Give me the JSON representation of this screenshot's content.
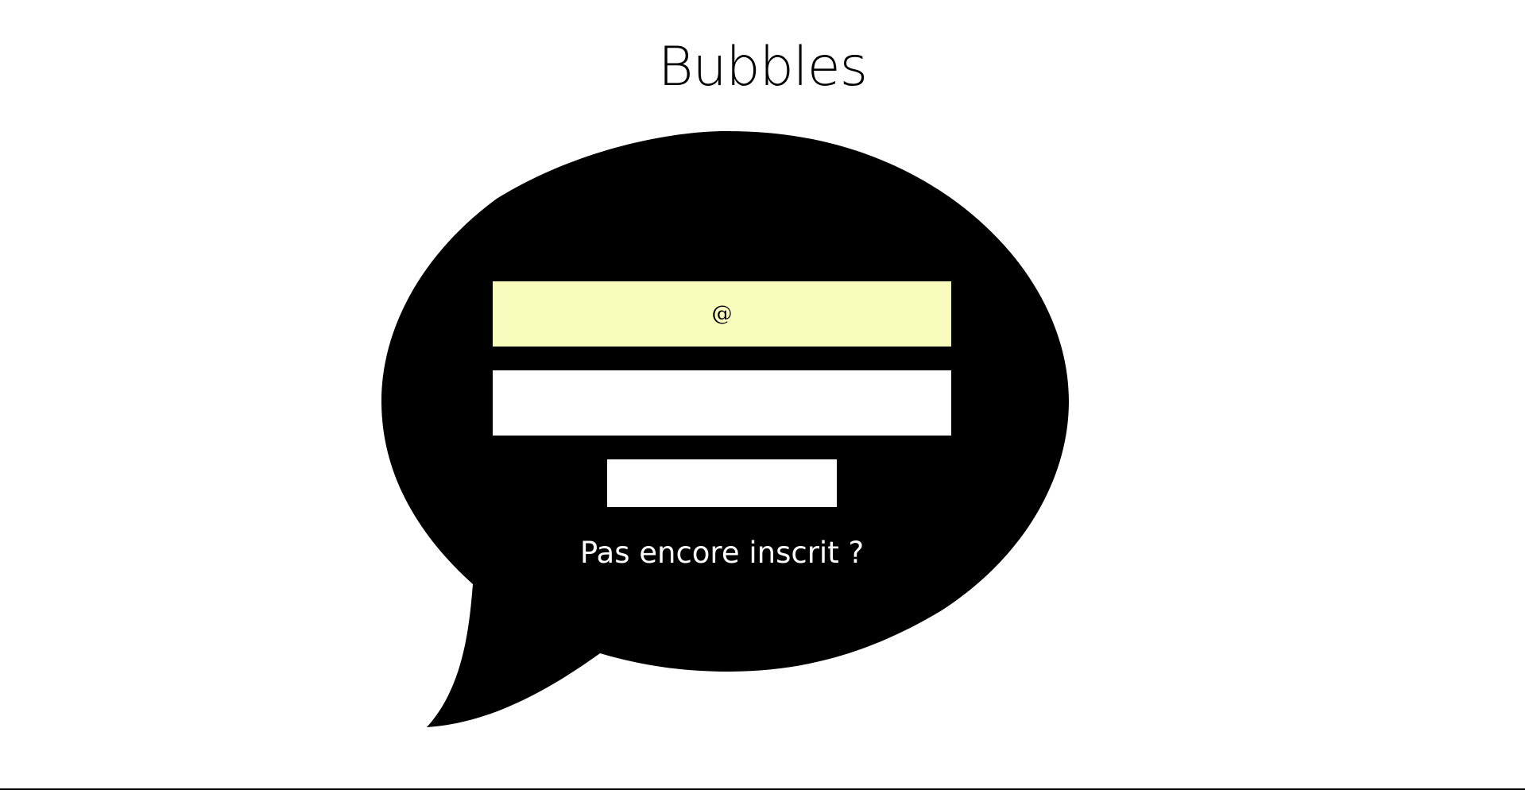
{
  "app": {
    "title": "Bubbles"
  },
  "login_form": {
    "email_placeholder": "@",
    "email_value": "",
    "password_placeholder": "",
    "password_value": "",
    "submit_label": "",
    "signup_link_label": "Pas encore inscrit ?"
  },
  "colors": {
    "bubble": "#000000",
    "email_field_bg": "#f8fcbc",
    "field_bg": "#ffffff",
    "link_text": "#ffffff",
    "background": "#ffffff"
  },
  "icons": {
    "bubble_shape": "speech-bubble"
  }
}
